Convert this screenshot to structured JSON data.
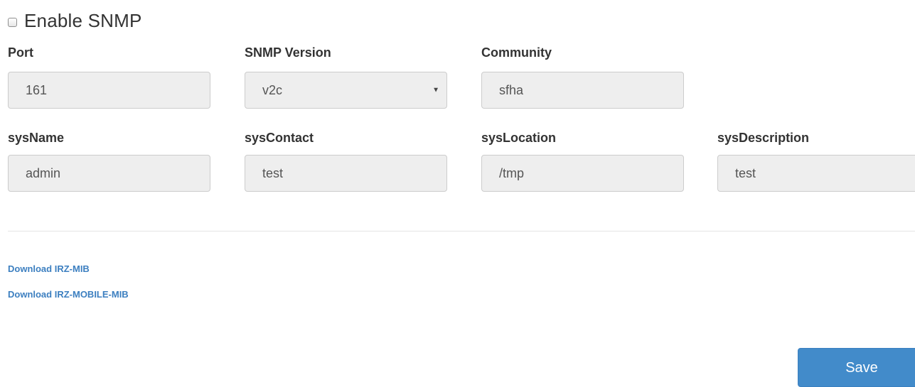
{
  "enable": {
    "label": "Enable SNMP",
    "checked": false
  },
  "row1": {
    "port": {
      "label": "Port",
      "value": "161"
    },
    "version": {
      "label": "SNMP Version",
      "value": "v2c"
    },
    "community": {
      "label": "Community",
      "value": "sfha"
    }
  },
  "row2": {
    "sysname": {
      "label": "sysName",
      "value": "admin"
    },
    "syscontact": {
      "label": "sysContact",
      "value": "test"
    },
    "syslocation": {
      "label": "sysLocation",
      "value": "/tmp"
    },
    "sysdescription": {
      "label": "sysDescription",
      "value": "test"
    }
  },
  "links": {
    "mib": "Download IRZ-MIB",
    "mobile_mib": "Download IRZ-MOBILE-MIB"
  },
  "save_label": "Save",
  "colors": {
    "primary": "#428bca",
    "link": "#3c7fc0",
    "input_bg": "#eeeeee"
  }
}
